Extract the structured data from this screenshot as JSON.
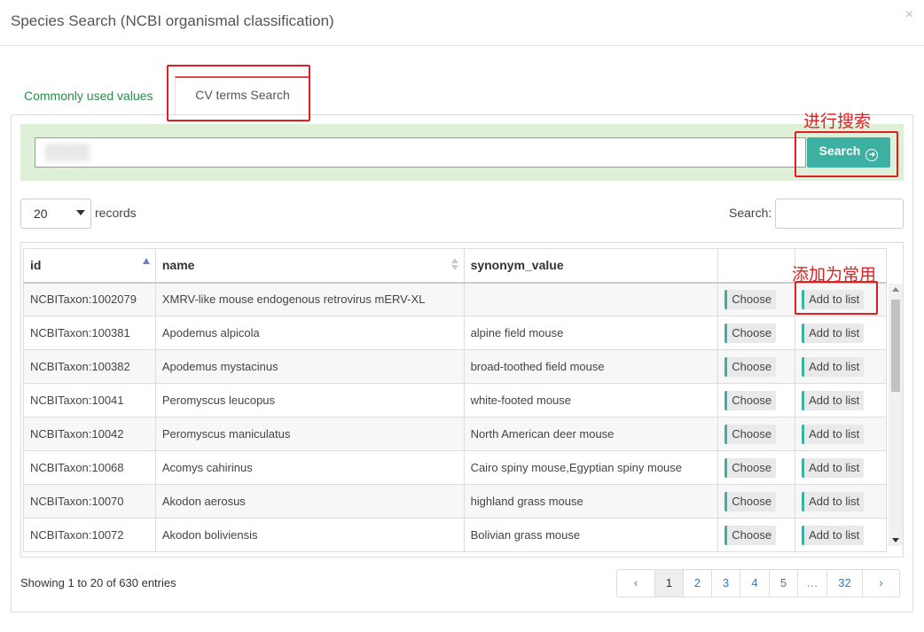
{
  "dialog": {
    "title": "Species Search (NCBI organismal classification)",
    "close_glyph": "×"
  },
  "tabs": {
    "common": "Commonly used values",
    "cv": "CV terms Search"
  },
  "search": {
    "value": "",
    "button_label": "Search",
    "button_icon": "arrow-circle-right-icon"
  },
  "length": {
    "value": "20",
    "label": "records"
  },
  "filter": {
    "label": "Search:",
    "value": ""
  },
  "table": {
    "columns": [
      "id",
      "name",
      "synonym_value",
      "",
      ""
    ],
    "choose_label": "Choose",
    "add_label": "Add to list",
    "rows": [
      {
        "id": "NCBITaxon:1002079",
        "name": "XMRV-like mouse endogenous retrovirus mERV-XL",
        "synonym": ""
      },
      {
        "id": "NCBITaxon:100381",
        "name": "Apodemus alpicola",
        "synonym": "alpine field mouse"
      },
      {
        "id": "NCBITaxon:100382",
        "name": "Apodemus mystacinus",
        "synonym": "broad-toothed field mouse"
      },
      {
        "id": "NCBITaxon:10041",
        "name": "Peromyscus leucopus",
        "synonym": "white-footed mouse"
      },
      {
        "id": "NCBITaxon:10042",
        "name": "Peromyscus maniculatus",
        "synonym": "North American deer mouse"
      },
      {
        "id": "NCBITaxon:10068",
        "name": "Acomys cahirinus",
        "synonym": "Cairo spiny mouse,Egyptian spiny mouse"
      },
      {
        "id": "NCBITaxon:10070",
        "name": "Akodon aerosus",
        "synonym": "highland grass mouse"
      },
      {
        "id": "NCBITaxon:10072",
        "name": "Akodon boliviensis",
        "synonym": "Bolivian grass mouse"
      }
    ]
  },
  "info": "Showing 1 to 20 of 630 entries",
  "pagination": [
    "‹",
    "1",
    "2",
    "3",
    "4",
    "5",
    "…",
    "32",
    "›"
  ],
  "pagination_active": "1",
  "annotations": {
    "search": "进行搜索",
    "add": "添加为常用"
  },
  "colors": {
    "accent": "#3bb0a3",
    "annotation": "#e02020",
    "tab_common": "#2a8a4a",
    "search_bar_bg": "#dff0d8"
  }
}
